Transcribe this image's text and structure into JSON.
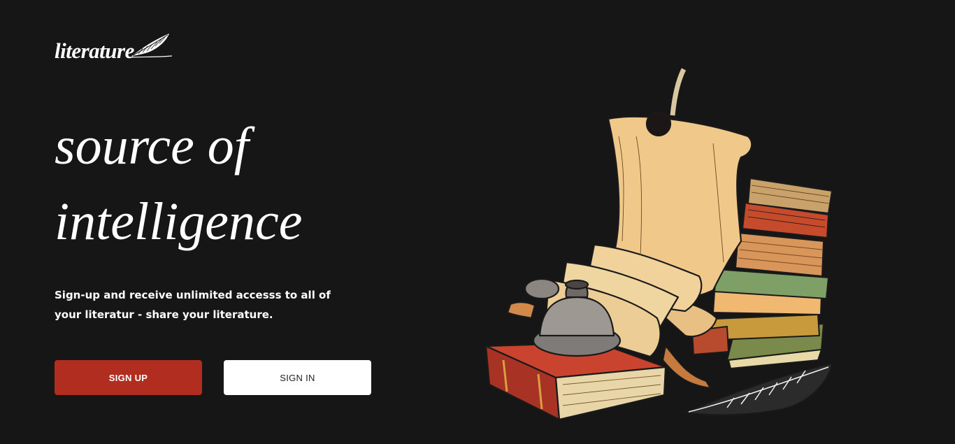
{
  "brand": {
    "name": "literature",
    "logo_icon": "quill-feather-icon"
  },
  "hero": {
    "title_line1": "source of",
    "title_line2": "intelligence",
    "description": "Sign-up and receive unlimited accesss to all of your literatur - share your literature."
  },
  "actions": {
    "sign_up_label": "SIGN UP",
    "sign_in_label": "SIGN IN"
  },
  "colors": {
    "background": "#161616",
    "primary": "#b02d1f",
    "secondary": "#ffffff",
    "text": "#ffffff"
  },
  "illustration": {
    "name": "books-scroll-inkwell-illustration"
  }
}
